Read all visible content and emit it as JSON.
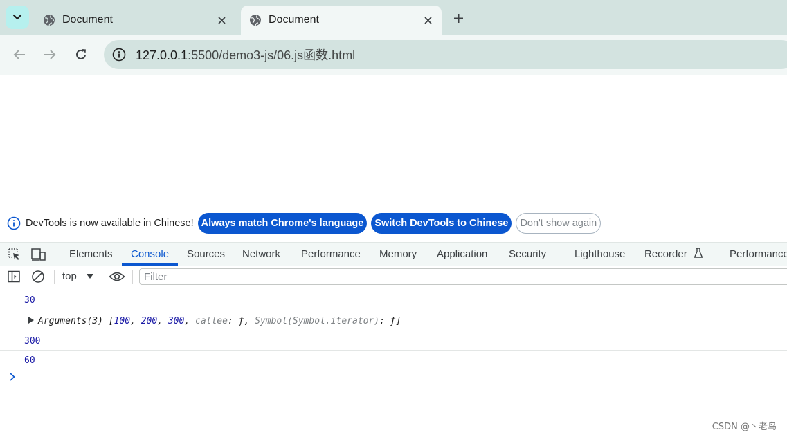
{
  "tabs": [
    {
      "title": "Document"
    },
    {
      "title": "Document"
    }
  ],
  "omnibox": {
    "host": "127.0.0.1",
    "path": ":5500/demo3-js/06.js函数.html"
  },
  "infobar": {
    "message": "DevTools is now available in Chinese!",
    "always_match": "Always match Chrome's language",
    "switch": "Switch DevTools to Chinese",
    "dont_show": "Don't show again"
  },
  "devtools": {
    "tabs": [
      "Elements",
      "Console",
      "Sources",
      "Network",
      "Performance",
      "Memory",
      "Application",
      "Security",
      "Lighthouse",
      "Recorder",
      "Performance"
    ],
    "selected_tab": "Console"
  },
  "console_toolbar": {
    "context": "top",
    "filter_placeholder": "Filter"
  },
  "console": {
    "log1": "30",
    "args": {
      "label": "Arguments(3)",
      "open": "[",
      "v1": "100",
      "v2": "200",
      "v3": "300",
      "callee_key": "callee",
      "callee_val": "ƒ",
      "sym_key": "Symbol(Symbol.iterator)",
      "sym_val": "ƒ",
      "close": "]"
    },
    "log3": "300",
    "log4": "60"
  },
  "watermark": "CSDN @丶老鸟",
  "colors": {
    "accent": "#0b57d0",
    "tabstrip": "#d3e3e0",
    "number": "#1a1aa6"
  }
}
